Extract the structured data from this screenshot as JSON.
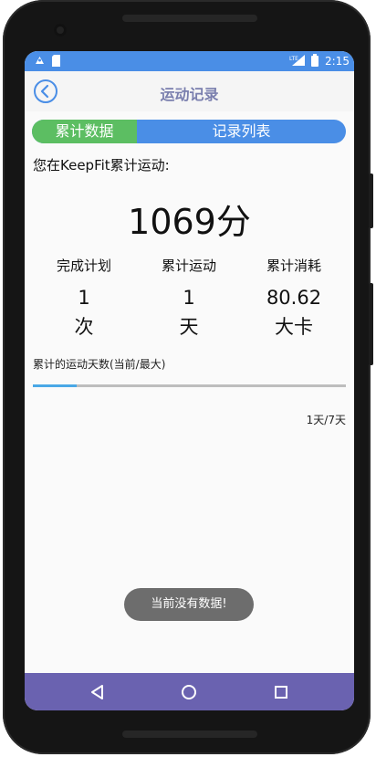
{
  "status_bar": {
    "time": "2:15",
    "icons": [
      "notification-icon",
      "sd-card-icon",
      "lte-signal-icon",
      "battery-icon"
    ]
  },
  "app_bar": {
    "title": "运动记录",
    "back_icon": "chevron-left-circle-icon"
  },
  "tabs": [
    {
      "label": "累计数据",
      "active": true,
      "color": "#5cbe62"
    },
    {
      "label": "记录列表",
      "active": false,
      "color": "#4a8ee6"
    }
  ],
  "summary": {
    "intro": "您在KeepFit累计运动:",
    "total": "1069分"
  },
  "stats": [
    {
      "label": "完成计划",
      "value": "1",
      "unit": "次"
    },
    {
      "label": "累计运动",
      "value": "1",
      "unit": "天"
    },
    {
      "label": "累计消耗",
      "value": "80.62",
      "unit": "大卡"
    }
  ],
  "progress": {
    "label": "累计的运动天数(当前/最大)",
    "fraction": 0.14,
    "text": "1天/7天"
  },
  "toast": {
    "message": "当前没有数据!"
  },
  "nav_bar": {
    "icons": [
      "back-triangle-icon",
      "home-circle-icon",
      "recents-square-icon"
    ]
  },
  "colors": {
    "status_bar": "#4a8ee6",
    "nav_bar": "#6a62b0",
    "title": "#7a7fae",
    "progress_fill": "#4aa8e6"
  }
}
